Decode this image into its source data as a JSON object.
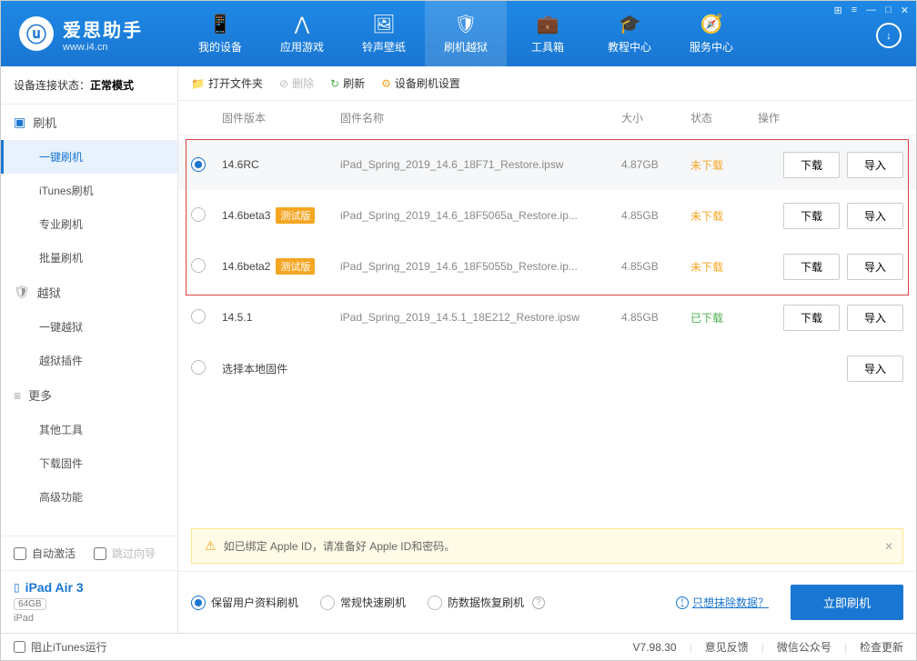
{
  "brand": {
    "name": "爱思助手",
    "site": "www.i4.cn"
  },
  "nav": [
    {
      "label": "我的设备",
      "icon": "📱"
    },
    {
      "label": "应用游戏",
      "icon": "⋀"
    },
    {
      "label": "铃声壁纸",
      "icon": "🖼"
    },
    {
      "label": "刷机越狱",
      "icon": "🛡"
    },
    {
      "label": "工具箱",
      "icon": "💼"
    },
    {
      "label": "教程中心",
      "icon": "🎓"
    },
    {
      "label": "服务中心",
      "icon": "🧭"
    }
  ],
  "device_status": {
    "label": "设备连接状态：",
    "value": "正常模式"
  },
  "sidebar": {
    "groups": [
      {
        "title": "刷机",
        "items": [
          "一键刷机",
          "iTunes刷机",
          "专业刷机",
          "批量刷机"
        ]
      },
      {
        "title": "越狱",
        "items": [
          "一键越狱",
          "越狱插件"
        ]
      },
      {
        "title": "更多",
        "items": [
          "其他工具",
          "下载固件",
          "高级功能"
        ]
      }
    ],
    "auto_activate": "自动激活",
    "skip_guide": "跳过向导",
    "device": {
      "name": "iPad Air 3",
      "capacity": "64GB",
      "type": "iPad"
    }
  },
  "toolbar": {
    "open": "打开文件夹",
    "delete": "删除",
    "refresh": "刷新",
    "settings": "设备刷机设置"
  },
  "columns": {
    "version": "固件版本",
    "name": "固件名称",
    "size": "大小",
    "status": "状态",
    "action": "操作"
  },
  "rows": [
    {
      "ver": "14.6RC",
      "beta": false,
      "name": "iPad_Spring_2019_14.6_18F71_Restore.ipsw",
      "size": "4.87GB",
      "status": "未下载",
      "status_cls": "status-undl",
      "download": true,
      "selected": true
    },
    {
      "ver": "14.6beta3",
      "beta": true,
      "name": "iPad_Spring_2019_14.6_18F5065a_Restore.ip...",
      "size": "4.85GB",
      "status": "未下载",
      "status_cls": "status-undl",
      "download": true,
      "selected": false
    },
    {
      "ver": "14.6beta2",
      "beta": true,
      "name": "iPad_Spring_2019_14.6_18F5055b_Restore.ip...",
      "size": "4.85GB",
      "status": "未下载",
      "status_cls": "status-undl",
      "download": true,
      "selected": false
    },
    {
      "ver": "14.5.1",
      "beta": false,
      "name": "iPad_Spring_2019_14.5.1_18E212_Restore.ipsw",
      "size": "4.85GB",
      "status": "已下载",
      "status_cls": "status-dl",
      "download": true,
      "selected": false
    },
    {
      "ver": "选择本地固件",
      "beta": false,
      "name": "",
      "size": "",
      "status": "",
      "status_cls": "",
      "download": false,
      "selected": false
    }
  ],
  "beta_badge": "测试版",
  "btn": {
    "download": "下载",
    "import": "导入"
  },
  "notice": "如已绑定 Apple ID，请准备好 Apple ID和密码。",
  "options": {
    "keep_data": "保留用户资料刷机",
    "normal": "常规快速刷机",
    "anti": "防数据恢复刷机",
    "erase_link": "只想抹除数据？",
    "flash_btn": "立即刷机"
  },
  "footer": {
    "block_itunes": "阻止iTunes运行",
    "version": "V7.98.30",
    "feedback": "意见反馈",
    "wechat": "微信公众号",
    "update": "检查更新"
  }
}
